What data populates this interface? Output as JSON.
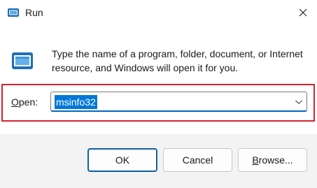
{
  "window": {
    "title": "Run",
    "app_icon": "run-app-icon"
  },
  "body": {
    "icon": "run-icon",
    "description": "Type the name of a program, folder, document, or Internet resource, and Windows will open it for you."
  },
  "open_field": {
    "label_mnemonic": "O",
    "label_rest": "pen:",
    "value": "msinfo32",
    "selected": true,
    "dropdown_icon": "chevron-down-icon"
  },
  "buttons": {
    "ok": {
      "label": "OK"
    },
    "cancel": {
      "label": "Cancel"
    },
    "browse": {
      "label_mnemonic": "B",
      "label_rest": "rowse..."
    }
  },
  "colors": {
    "highlight_border": "#d3232d",
    "selection": "#0078d7",
    "accent": "#0067c0",
    "footer_bg": "#f3f3f3"
  }
}
